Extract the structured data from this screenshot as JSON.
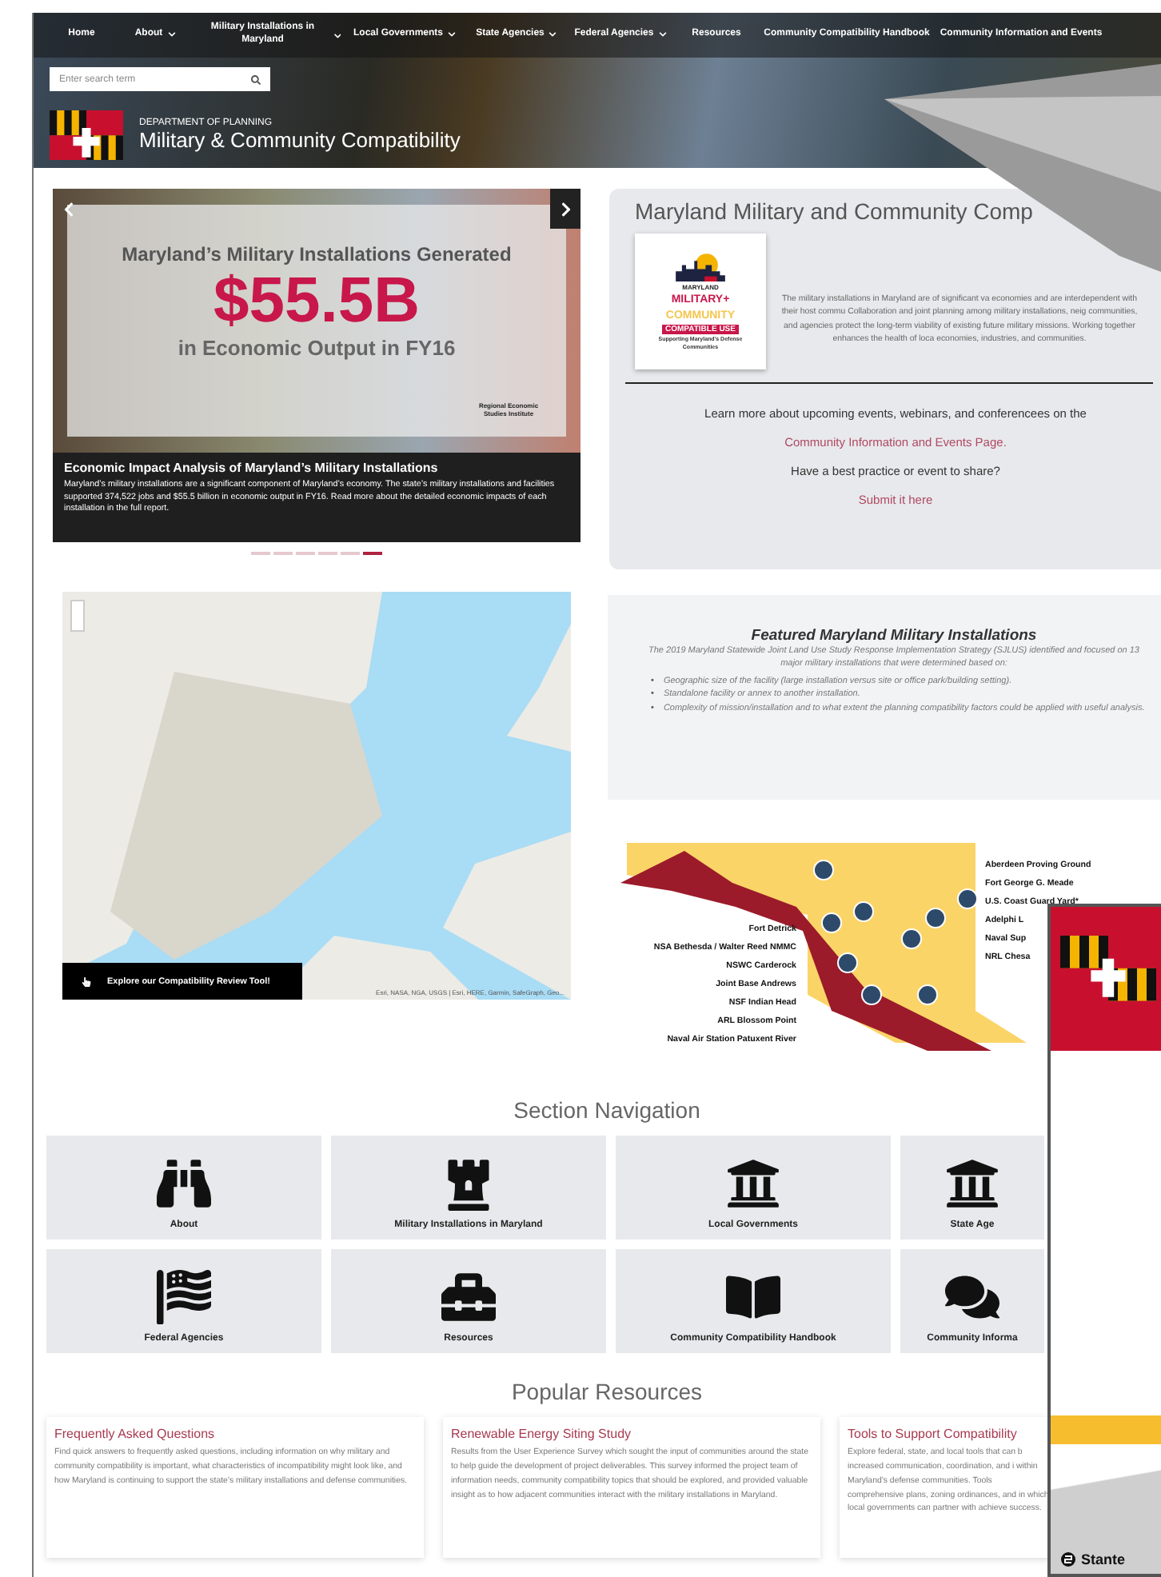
{
  "nav": {
    "items": [
      {
        "label": "Home",
        "dropdown": false
      },
      {
        "label": "About",
        "dropdown": true
      },
      {
        "label": "Military Installations in Maryland",
        "dropdown": true
      },
      {
        "label": "Local Governments",
        "dropdown": true
      },
      {
        "label": "State Agencies",
        "dropdown": true
      },
      {
        "label": "Federal Agencies",
        "dropdown": true
      },
      {
        "label": "Resources",
        "dropdown": false
      },
      {
        "label": "Community Compatibility Handbook",
        "dropdown": false
      },
      {
        "label": "Community Information and Events",
        "dropdown": false
      }
    ],
    "search_placeholder": "Enter search term"
  },
  "header": {
    "department": "DEPARTMENT OF PLANNING",
    "title": "Military & Community Compatibility"
  },
  "carousel": {
    "headline": "Maryland’s Military Installations Generated",
    "amount": "$55.5B",
    "subline": "in Economic Output in FY16",
    "credit": "Regional Economic Studies Institute",
    "caption_title": "Economic Impact Analysis of Maryland’s Military Installations",
    "caption_text": "Maryland’s military installations are a significant component of Maryland’s economy. The state’s military installations and facilities supported 374,522 jobs and $55.5 billion in economic output in FY16. Read more about the detailed economic impacts of each installation in the full report.",
    "indicators": [
      {
        "selected": false
      },
      {
        "selected": false
      },
      {
        "selected": false
      },
      {
        "selected": false
      },
      {
        "selected": false
      },
      {
        "selected": true
      }
    ]
  },
  "intro": {
    "title": "Maryland Military and Community Comp",
    "logo": {
      "state": "MARYLAND",
      "line1": "MILITARY+",
      "line2": "COMMUNITY",
      "badge": "COMPATIBLE USE",
      "tagline": "Supporting Maryland’s Defense Communities"
    },
    "text": "The military installations in Maryland are of significant va economies and are interdependent with their host commu Collaboration and joint planning among military installations, neig communities, and agencies protect the long-term viability of existing future military missions. Working together enhances the health of loca economies, industries, and communities.",
    "events_text": "Learn more about upcoming events, webinars, and conferencees on the",
    "events_link": "Community Information and Events Page.",
    "share_text": "Have a best practice or event to share?",
    "share_link": "Submit it here"
  },
  "map": {
    "attribution": "Esri, NASA, NGA, USGS | Esri, HERE, Garmin, SafeGraph, Geo...",
    "button": "Explore our Compatibility Review Tool!"
  },
  "featured": {
    "marker": "•",
    "title": "Featured Maryland Military Installations",
    "intro": "The 2019 Maryland Statewide Joint Land Use Study Response Implementation Strategy (SJLUS) identified and focused on 13 major military installations that were determined based on:",
    "bullets": [
      "Geographic size of the facility (large installation versus site or office park/building setting).",
      "Standalone facility or annex to another installation.",
      "Complexity of mission/installation and to what extent the planning compatibility factors could be applied with useful analysis."
    ]
  },
  "installations": {
    "left": [
      "Fort Detrick",
      "NSA Bethesda / Walter Reed NMMC",
      "NSWC Carderock",
      "Joint Base Andrews",
      "NSF Indian Head",
      "ARL Blossom Point",
      "Naval Air Station Patuxent River"
    ],
    "right": [
      "Aberdeen Proving Ground",
      "Fort George G. Meade",
      "U.S. Coast Guard Yard*",
      "Adelphi L",
      "Naval Sup",
      "NRL Chesa"
    ]
  },
  "section_nav": {
    "title": "Section Navigation",
    "items": [
      {
        "label": "About",
        "kind": "binoculars"
      },
      {
        "label": "Military Installations in Maryland",
        "kind": "tower"
      },
      {
        "label": "Local Governments",
        "kind": "building"
      },
      {
        "label": "State Age",
        "kind": "building"
      },
      {
        "label": "Federal Agencies",
        "kind": "flag"
      },
      {
        "label": "Resources",
        "kind": "toolbox"
      },
      {
        "label": "Community Compatibility Handbook",
        "kind": "book"
      },
      {
        "label": "Community Informa",
        "kind": "chat"
      }
    ]
  },
  "popular": {
    "title": "Popular Resources",
    "cards": [
      {
        "title": "Frequently Asked Questions",
        "text": "Find quick answers to frequently asked questions, including information on why military and community compatibility is important, what characteristics of incompatibility might look like, and how Maryland is continuing to support the state’s military installations and defense communities."
      },
      {
        "title": "Renewable Energy Siting Study",
        "text": "Results from the User Experience Survey which sought the input of communities around the state to help guide the development of project deliverables. This survey informed the project team of information needs, community compatibility topics that should be explored, and provided valuable insight as to how adjacent communities interact with the military installations in Maryland."
      },
      {
        "title": "Tools to Support Compatibility",
        "text": "Explore federal, state, and local tools that can b increased communication, coordination, and i within Maryland’s defense communities. Tools comprehensive plans, zoning ordinances, and in which local governments can partner with achieve success."
      }
    ]
  },
  "document": {
    "brand": "Stante"
  }
}
